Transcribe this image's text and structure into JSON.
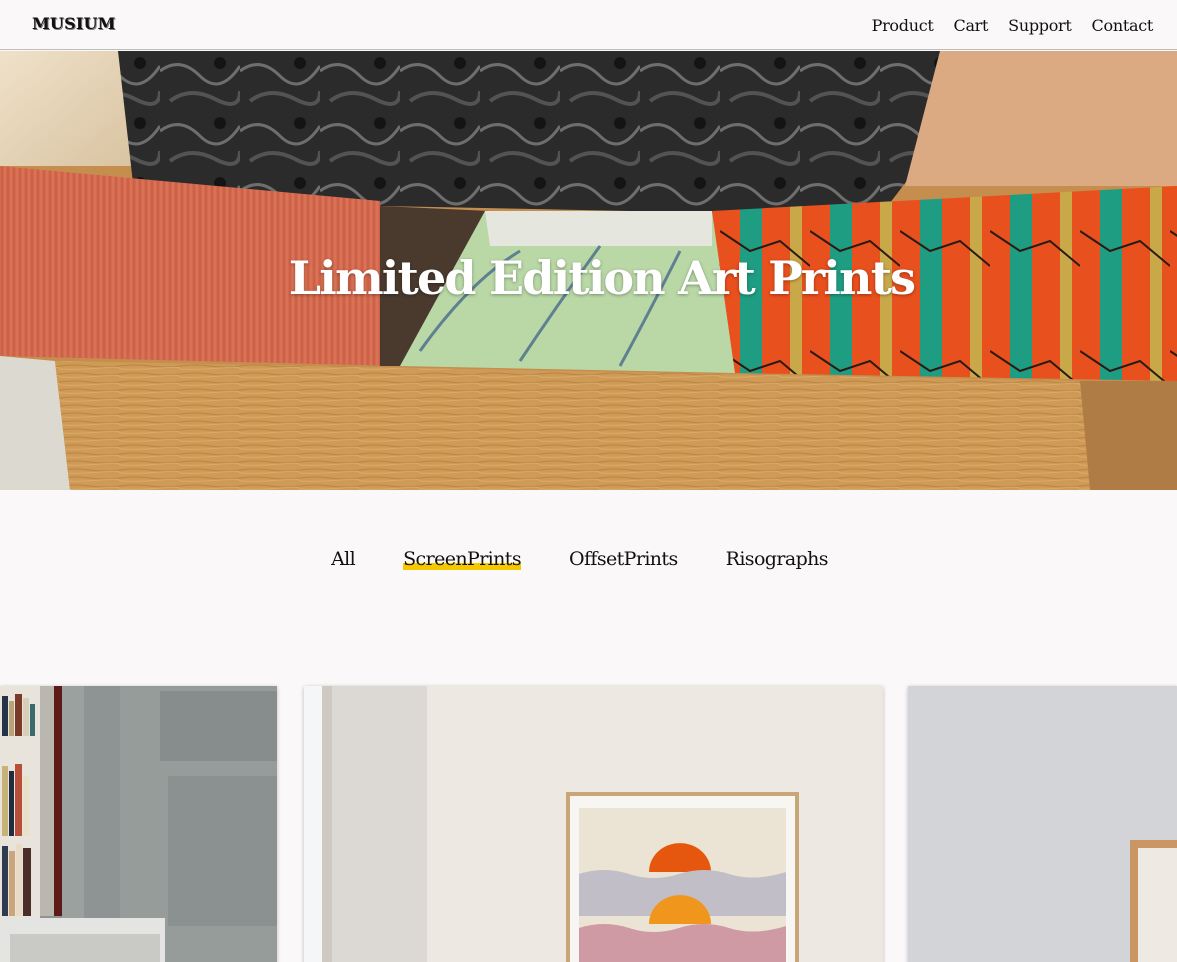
{
  "header": {
    "logo": "MUSIUM",
    "nav": [
      "Product",
      "Cart",
      "Support",
      "Contact"
    ]
  },
  "hero": {
    "title": "Limited Edition Art Prints"
  },
  "filters": {
    "items": [
      "All",
      "ScreenPrints",
      "OffsetPrints",
      "Risographs"
    ],
    "active": "ScreenPrints",
    "accent": "#f6c800"
  },
  "products": [
    {
      "image": "bookshelf-room-print"
    },
    {
      "image": "sunset-waves-framed-print"
    },
    {
      "image": "wood-frame-wall-print"
    }
  ]
}
